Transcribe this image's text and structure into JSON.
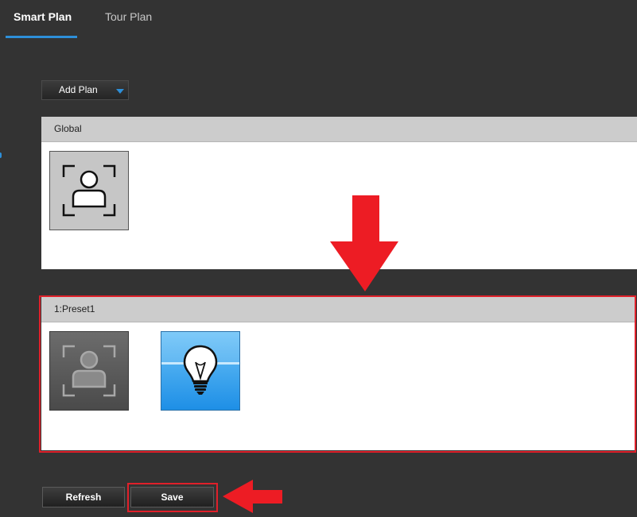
{
  "tabs": [
    {
      "label": "Smart Plan",
      "active": true
    },
    {
      "label": "Tour Plan",
      "active": false
    }
  ],
  "add_plan": {
    "label": "Add Plan",
    "icon": "chevron-down-icon"
  },
  "panels": {
    "global": {
      "title": "Global",
      "items": [
        {
          "icon": "face-detection-icon",
          "state": "enabled"
        }
      ]
    },
    "preset": {
      "title": "1:Preset1",
      "items": [
        {
          "icon": "face-detection-icon",
          "state": "disabled"
        },
        {
          "icon": "lightbulb-icon",
          "state": "selected"
        }
      ]
    }
  },
  "buttons": {
    "refresh": "Refresh",
    "save": "Save"
  },
  "colors": {
    "accent": "#2d8fd9",
    "annotation": "#e0202a",
    "background": "#333333",
    "panel_header": "#cccccc"
  }
}
